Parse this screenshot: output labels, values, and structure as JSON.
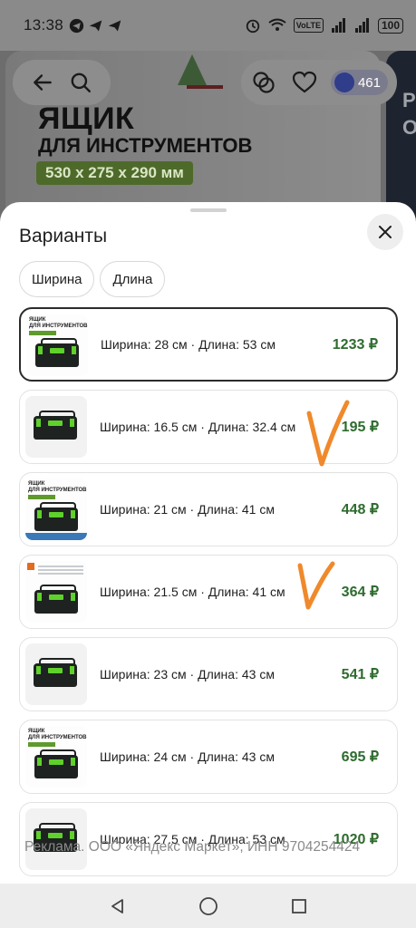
{
  "status_bar": {
    "time": "13:38",
    "volte": "VoLTE",
    "battery": "100"
  },
  "product_banner": {
    "title_line1": "ЯЩИК",
    "title_line2": "ДЛЯ ИНСТРУМЕНТОВ",
    "dimensions": "530 x 275 x 290 мм",
    "side_text": "Pr\nO"
  },
  "top_actions": {
    "cashback_value": "461"
  },
  "sheet": {
    "title": "Варианты",
    "filters": [
      "Ширина",
      "Длина"
    ],
    "variants": [
      {
        "spec": "Ширина: 28 см · Длина: 53 см",
        "price": "1233 ₽",
        "selected": true
      },
      {
        "spec": "Ширина: 16.5 см · Длина: 32.4 см",
        "price": "195 ₽",
        "selected": false
      },
      {
        "spec": "Ширина: 21 см · Длина: 41 см",
        "price": "448 ₽",
        "selected": false
      },
      {
        "spec": "Ширина: 21.5 см · Длина: 41 см",
        "price": "364 ₽",
        "selected": false
      },
      {
        "spec": "Ширина: 23 см · Длина: 43 см",
        "price": "541 ₽",
        "selected": false
      },
      {
        "spec": "Ширина: 24 см · Длина: 43 см",
        "price": "695 ₽",
        "selected": false
      },
      {
        "spec": "Ширина: 27.5 см · Длина: 53 см",
        "price": "1020 ₽",
        "selected": false
      }
    ],
    "poster_text": "ЯЩИК\nДЛЯ ИНСТРУМЕНТОВ"
  },
  "ad_disclaimer": "Реклама. ООО «Яндекс Маркет», ИНН 9704254424",
  "colors": {
    "price_green": "#2e6b2e",
    "check_orange": "#f0892b",
    "selected_border": "#2b2b2b"
  }
}
